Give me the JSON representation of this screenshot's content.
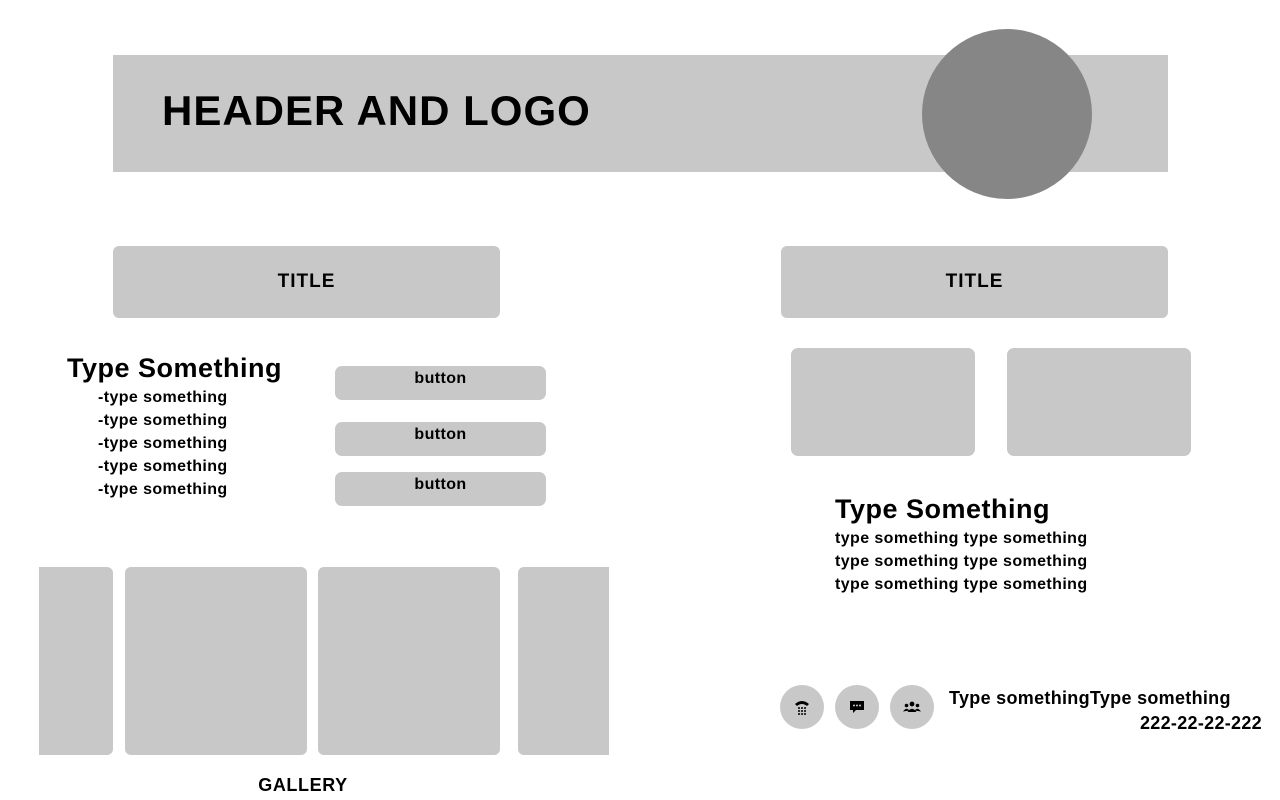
{
  "header": {
    "title": "HEADER AND LOGO"
  },
  "left_panel": {
    "title": "TITLE",
    "heading": "Type Something",
    "items": [
      "-type something",
      "-type something",
      "-type something",
      "-type something",
      "-type something"
    ],
    "buttons": [
      "button",
      "button",
      "button"
    ]
  },
  "gallery": {
    "label": "GALLERY"
  },
  "right_panel": {
    "title": "TITLE",
    "heading": "Type Something",
    "lines": [
      "type something type something",
      "type something type something",
      "type something type something"
    ]
  },
  "contact": {
    "icons": [
      "phone-icon",
      "chat-icon",
      "group-icon"
    ],
    "line1_a": "Type something",
    "line1_b": "Type something",
    "line2": "222-22-22-222"
  },
  "colors": {
    "panel": "#c8c8c8",
    "logo": "#868686",
    "text": "#000000",
    "background": "#ffffff"
  }
}
